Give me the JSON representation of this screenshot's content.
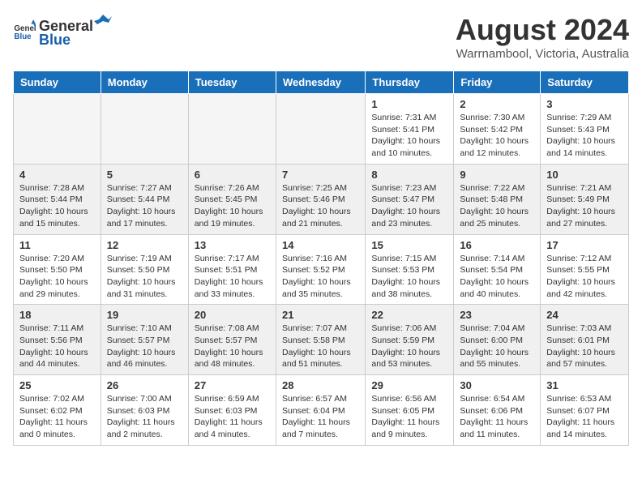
{
  "header": {
    "logo_general": "General",
    "logo_blue": "Blue",
    "month_year": "August 2024",
    "location": "Warrnambool, Victoria, Australia"
  },
  "weekdays": [
    "Sunday",
    "Monday",
    "Tuesday",
    "Wednesday",
    "Thursday",
    "Friday",
    "Saturday"
  ],
  "weeks": [
    [
      {
        "day": "",
        "info": ""
      },
      {
        "day": "",
        "info": ""
      },
      {
        "day": "",
        "info": ""
      },
      {
        "day": "",
        "info": ""
      },
      {
        "day": "1",
        "info": "Sunrise: 7:31 AM\nSunset: 5:41 PM\nDaylight: 10 hours\nand 10 minutes."
      },
      {
        "day": "2",
        "info": "Sunrise: 7:30 AM\nSunset: 5:42 PM\nDaylight: 10 hours\nand 12 minutes."
      },
      {
        "day": "3",
        "info": "Sunrise: 7:29 AM\nSunset: 5:43 PM\nDaylight: 10 hours\nand 14 minutes."
      }
    ],
    [
      {
        "day": "4",
        "info": "Sunrise: 7:28 AM\nSunset: 5:44 PM\nDaylight: 10 hours\nand 15 minutes."
      },
      {
        "day": "5",
        "info": "Sunrise: 7:27 AM\nSunset: 5:44 PM\nDaylight: 10 hours\nand 17 minutes."
      },
      {
        "day": "6",
        "info": "Sunrise: 7:26 AM\nSunset: 5:45 PM\nDaylight: 10 hours\nand 19 minutes."
      },
      {
        "day": "7",
        "info": "Sunrise: 7:25 AM\nSunset: 5:46 PM\nDaylight: 10 hours\nand 21 minutes."
      },
      {
        "day": "8",
        "info": "Sunrise: 7:23 AM\nSunset: 5:47 PM\nDaylight: 10 hours\nand 23 minutes."
      },
      {
        "day": "9",
        "info": "Sunrise: 7:22 AM\nSunset: 5:48 PM\nDaylight: 10 hours\nand 25 minutes."
      },
      {
        "day": "10",
        "info": "Sunrise: 7:21 AM\nSunset: 5:49 PM\nDaylight: 10 hours\nand 27 minutes."
      }
    ],
    [
      {
        "day": "11",
        "info": "Sunrise: 7:20 AM\nSunset: 5:50 PM\nDaylight: 10 hours\nand 29 minutes."
      },
      {
        "day": "12",
        "info": "Sunrise: 7:19 AM\nSunset: 5:50 PM\nDaylight: 10 hours\nand 31 minutes."
      },
      {
        "day": "13",
        "info": "Sunrise: 7:17 AM\nSunset: 5:51 PM\nDaylight: 10 hours\nand 33 minutes."
      },
      {
        "day": "14",
        "info": "Sunrise: 7:16 AM\nSunset: 5:52 PM\nDaylight: 10 hours\nand 35 minutes."
      },
      {
        "day": "15",
        "info": "Sunrise: 7:15 AM\nSunset: 5:53 PM\nDaylight: 10 hours\nand 38 minutes."
      },
      {
        "day": "16",
        "info": "Sunrise: 7:14 AM\nSunset: 5:54 PM\nDaylight: 10 hours\nand 40 minutes."
      },
      {
        "day": "17",
        "info": "Sunrise: 7:12 AM\nSunset: 5:55 PM\nDaylight: 10 hours\nand 42 minutes."
      }
    ],
    [
      {
        "day": "18",
        "info": "Sunrise: 7:11 AM\nSunset: 5:56 PM\nDaylight: 10 hours\nand 44 minutes."
      },
      {
        "day": "19",
        "info": "Sunrise: 7:10 AM\nSunset: 5:57 PM\nDaylight: 10 hours\nand 46 minutes."
      },
      {
        "day": "20",
        "info": "Sunrise: 7:08 AM\nSunset: 5:57 PM\nDaylight: 10 hours\nand 48 minutes."
      },
      {
        "day": "21",
        "info": "Sunrise: 7:07 AM\nSunset: 5:58 PM\nDaylight: 10 hours\nand 51 minutes."
      },
      {
        "day": "22",
        "info": "Sunrise: 7:06 AM\nSunset: 5:59 PM\nDaylight: 10 hours\nand 53 minutes."
      },
      {
        "day": "23",
        "info": "Sunrise: 7:04 AM\nSunset: 6:00 PM\nDaylight: 10 hours\nand 55 minutes."
      },
      {
        "day": "24",
        "info": "Sunrise: 7:03 AM\nSunset: 6:01 PM\nDaylight: 10 hours\nand 57 minutes."
      }
    ],
    [
      {
        "day": "25",
        "info": "Sunrise: 7:02 AM\nSunset: 6:02 PM\nDaylight: 11 hours\nand 0 minutes."
      },
      {
        "day": "26",
        "info": "Sunrise: 7:00 AM\nSunset: 6:03 PM\nDaylight: 11 hours\nand 2 minutes."
      },
      {
        "day": "27",
        "info": "Sunrise: 6:59 AM\nSunset: 6:03 PM\nDaylight: 11 hours\nand 4 minutes."
      },
      {
        "day": "28",
        "info": "Sunrise: 6:57 AM\nSunset: 6:04 PM\nDaylight: 11 hours\nand 7 minutes."
      },
      {
        "day": "29",
        "info": "Sunrise: 6:56 AM\nSunset: 6:05 PM\nDaylight: 11 hours\nand 9 minutes."
      },
      {
        "day": "30",
        "info": "Sunrise: 6:54 AM\nSunset: 6:06 PM\nDaylight: 11 hours\nand 11 minutes."
      },
      {
        "day": "31",
        "info": "Sunrise: 6:53 AM\nSunset: 6:07 PM\nDaylight: 11 hours\nand 14 minutes."
      }
    ]
  ]
}
